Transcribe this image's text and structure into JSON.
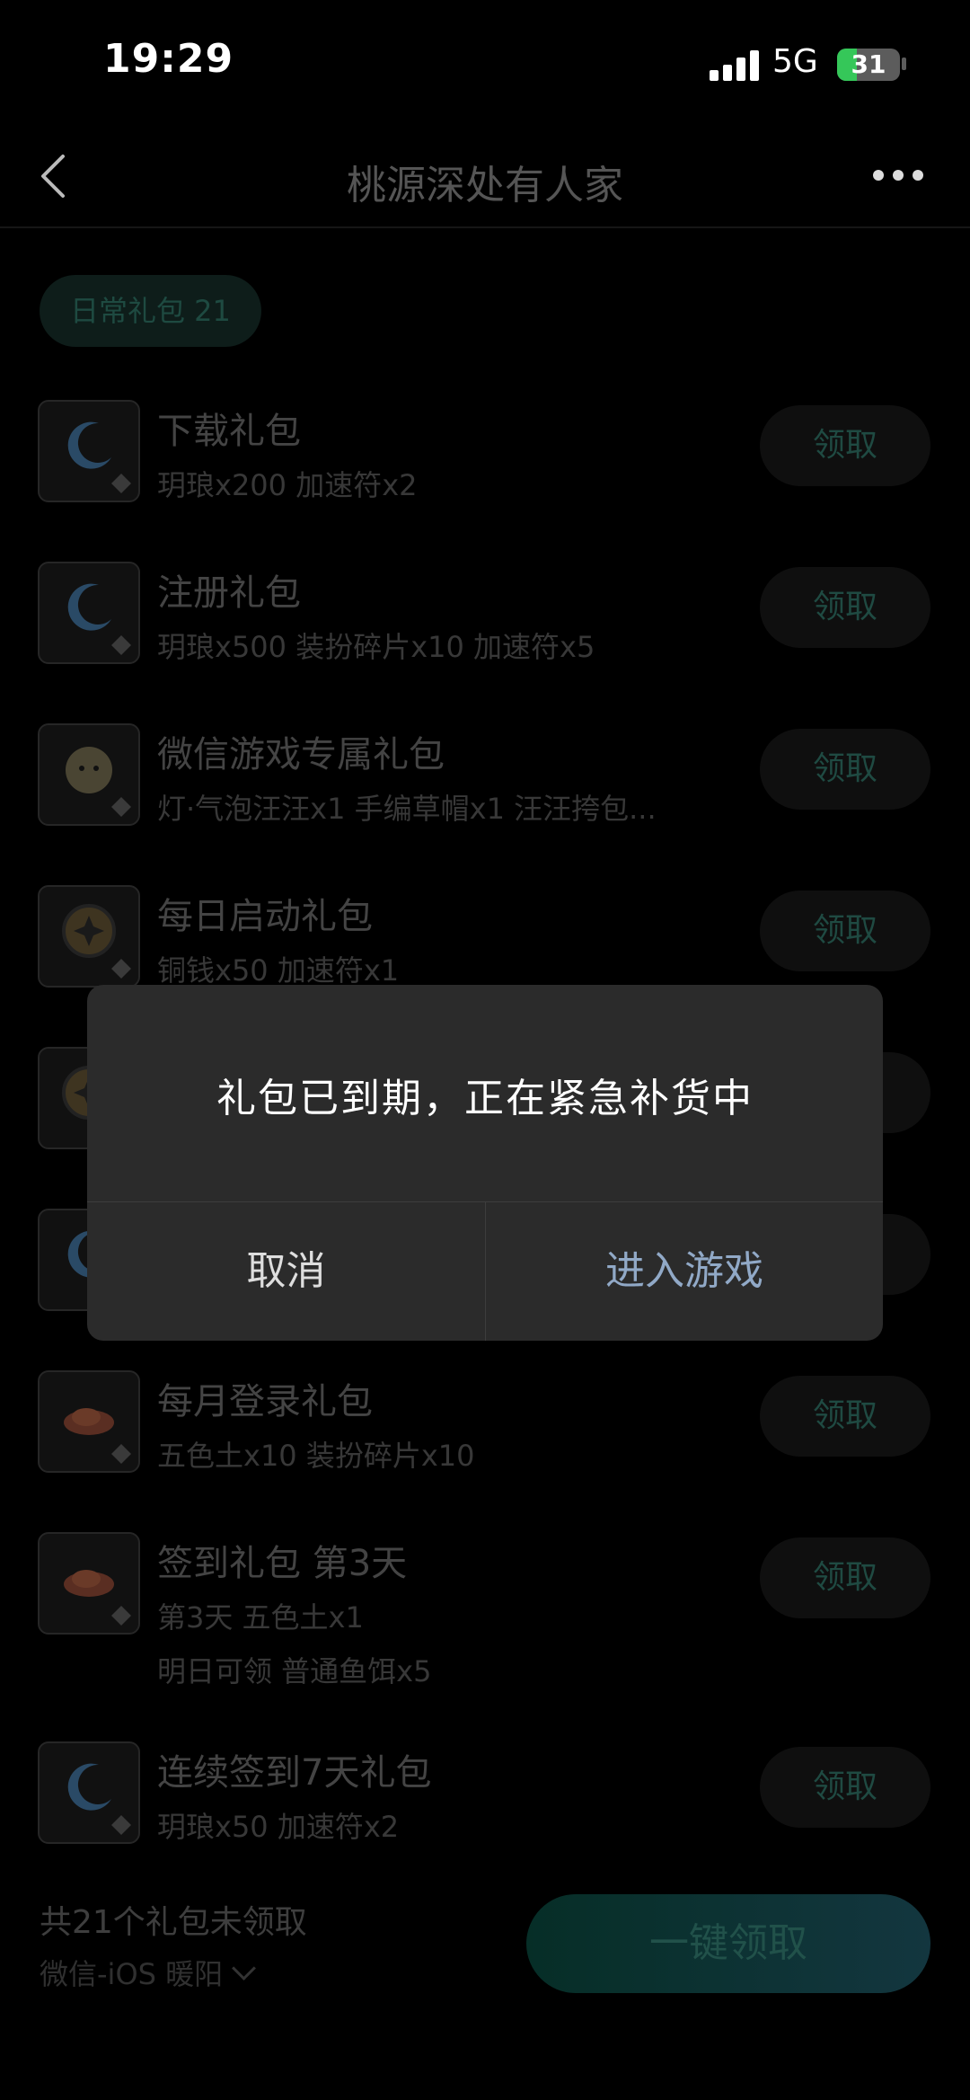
{
  "status_bar": {
    "time": "19:29",
    "network": "5G",
    "battery": "31",
    "battery_level": 0.31
  },
  "header": {
    "title": "桃源深处有人家"
  },
  "section_tag": "日常礼包 21",
  "gifts": [
    {
      "name": "下载礼包",
      "desc": "玥琅x200 加速符x2",
      "claim": "领取",
      "icon": "moon-icon"
    },
    {
      "name": "注册礼包",
      "desc": "玥琅x500 装扮碎片x10 加速符x5",
      "claim": "领取",
      "icon": "moon-icon"
    },
    {
      "name": "微信游戏专属礼包",
      "desc": "灯·气泡汪汪x1 手编草帽x1 汪汪挎包...",
      "claim": "领取",
      "icon": "puppy-icon"
    },
    {
      "name": "每日启动礼包",
      "desc": "铜钱x50 加速符x1",
      "claim": "领取",
      "icon": "coin-icon"
    },
    {
      "name": "",
      "desc": "",
      "claim": "",
      "icon": "coin-icon"
    },
    {
      "name": "",
      "desc": "",
      "claim": "",
      "icon": "moon-icon"
    },
    {
      "name": "每月登录礼包",
      "desc": "五色土x10 装扮碎片x10",
      "claim": "领取",
      "icon": "soil-icon"
    },
    {
      "name": "签到礼包 第3天",
      "desc": "第3天 五色土x1",
      "desc2": "明日可领 普通鱼饵x5",
      "claim": "领取",
      "icon": "soil-icon"
    },
    {
      "name": "连续签到7天礼包",
      "desc": "玥琅x50 加速符x2",
      "claim": "领取",
      "icon": "moon-icon"
    }
  ],
  "footer": {
    "count_text": "共21个礼包未领取",
    "account": "微信-iOS 暖阳",
    "claim_all": "一键领取"
  },
  "dialog": {
    "message": "礼包已到期，正在紧急补货中",
    "cancel": "取消",
    "confirm": "进入游戏"
  },
  "colors": {
    "accent": "#1f4a42",
    "dialog_bg": "#2b2b2b",
    "confirm_text": "#91a9c7"
  }
}
